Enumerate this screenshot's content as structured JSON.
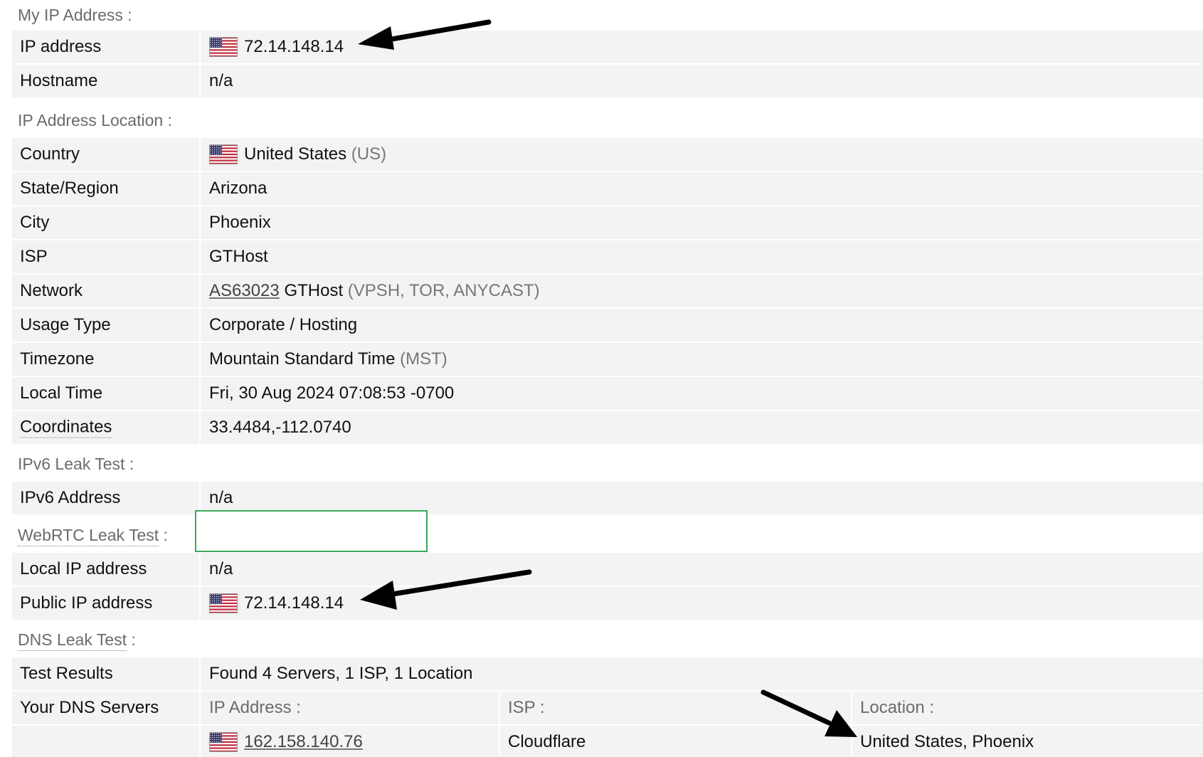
{
  "my_ip": {
    "title": "My IP Address :",
    "ip_label": "IP address",
    "ip_value": "72.14.148.14",
    "hostname_label": "Hostname",
    "hostname_value": "n/a"
  },
  "location": {
    "title": "IP Address Location :",
    "country_label": "Country",
    "country_value": "United States",
    "country_code": "(US)",
    "region_label": "State/Region",
    "region_value": "Arizona",
    "city_label": "City",
    "city_value": "Phoenix",
    "isp_label": "ISP",
    "isp_value": "GTHost",
    "network_label": "Network",
    "network_as": "AS63023",
    "network_name": "GTHost",
    "network_tags": "(VPSH, TOR, ANYCAST)",
    "usage_label": "Usage Type",
    "usage_value": "Corporate / Hosting",
    "timezone_label": "Timezone",
    "timezone_value": "Mountain Standard Time",
    "timezone_abbr": "(MST)",
    "localtime_label": "Local Time",
    "localtime_value": "Fri, 30 Aug 2024 07:08:53 -0700",
    "coords_label": "Coordinates",
    "coords_value": "33.4484,-112.0740"
  },
  "ipv6": {
    "title": "IPv6 Leak Test :",
    "address_label": "IPv6 Address",
    "address_value": "n/a"
  },
  "webrtc": {
    "title": "WebRTC Leak Test",
    "title_suffix": " :",
    "local_label": "Local IP address",
    "local_value": "n/a",
    "public_label": "Public IP address",
    "public_value": "72.14.148.14"
  },
  "dns": {
    "title": "DNS Leak Test",
    "title_suffix": " :",
    "results_label": "Test Results",
    "results_value": "Found 4 Servers, 1 ISP, 1 Location",
    "servers_label": "Your DNS Servers",
    "col_ip": "IP Address :",
    "col_isp": "ISP :",
    "col_location": "Location :",
    "server_ip": "162.158.140.76",
    "server_isp": "Cloudflare",
    "server_location": "United States, Phoenix"
  },
  "colors": {
    "row_bg": "#f3f3f3",
    "muted_text": "#6b6b6b",
    "webrtc_box_border": "#3aa85a",
    "arrow": "#000000"
  },
  "icons": {
    "flag": "us-flag-icon",
    "arrow": "black-arrow-annotation"
  }
}
